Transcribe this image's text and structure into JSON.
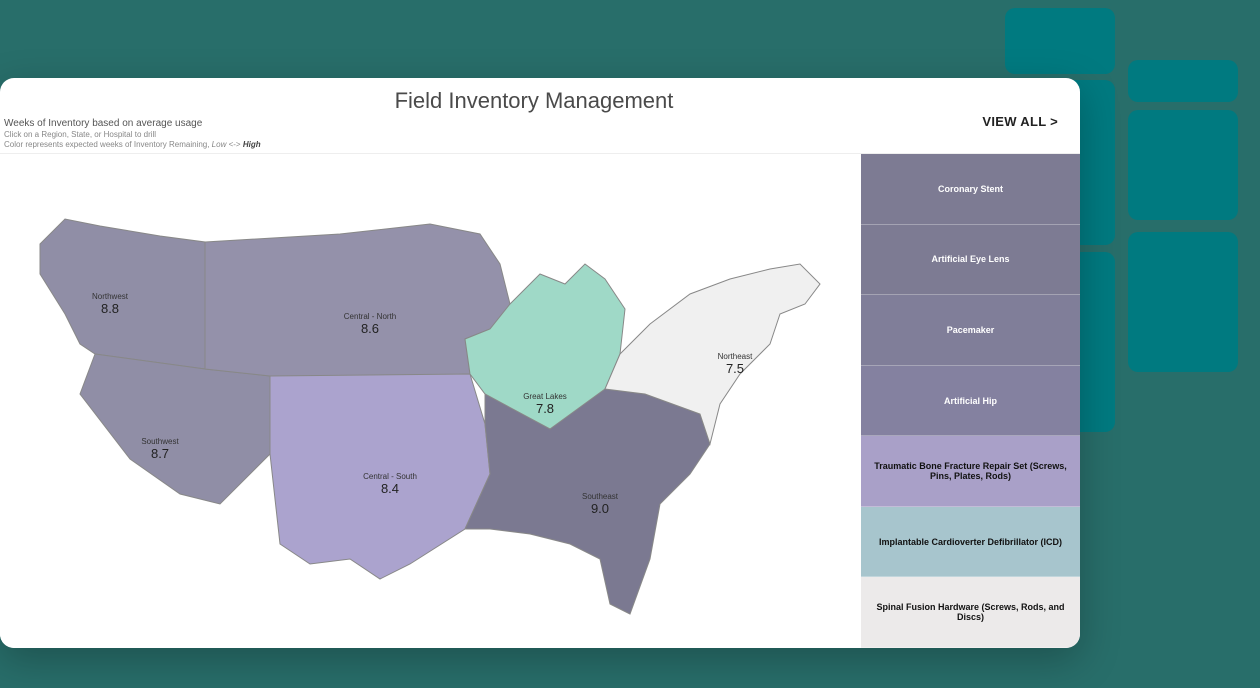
{
  "title": "Field Inventory Management",
  "subtitle1": "Weeks of Inventory based on average usage",
  "subtitle2": "Click on a Region, State, or Hospital to drill",
  "subtitle3_prefix": "Color represents expected weeks of Inventory Remaining, ",
  "subtitle3_low": "Low",
  "subtitle3_sep": " <-> ",
  "subtitle3_high": "High",
  "view_all": "VIEW ALL >",
  "regions": {
    "northwest": {
      "name": "Northwest",
      "value": "8.8",
      "color": "#908ea6"
    },
    "southwest": {
      "name": "Southwest",
      "value": "8.7",
      "color": "#908ea6"
    },
    "central_north": {
      "name": "Central - North",
      "value": "8.6",
      "color": "#9491aa"
    },
    "central_south": {
      "name": "Central - South",
      "value": "8.4",
      "color": "#aba3ce"
    },
    "great_lakes": {
      "name": "Great Lakes",
      "value": "7.8",
      "color": "#9fd9c7"
    },
    "southeast": {
      "name": "Southeast",
      "value": "9.0",
      "color": "#7b7991"
    },
    "northeast": {
      "name": "Northeast",
      "value": "7.5",
      "color": "#f0f0f0"
    }
  },
  "products": [
    "Coronary Stent",
    "Artificial Eye Lens",
    "Pacemaker",
    "Artificial Hip",
    "Traumatic Bone Fracture Repair Set (Screws, Pins, Plates, Rods)",
    "Implantable Cardioverter Defibrillator (ICD)",
    "Spinal Fusion Hardware (Screws, Rods, and Discs)"
  ],
  "chart_data": {
    "type": "choropleth-map",
    "title": "Weeks of Inventory based on average usage",
    "unit": "weeks",
    "regions": [
      {
        "name": "Northwest",
        "value": 8.8
      },
      {
        "name": "Southwest",
        "value": 8.7
      },
      {
        "name": "Central - North",
        "value": 8.6
      },
      {
        "name": "Central - South",
        "value": 8.4
      },
      {
        "name": "Great Lakes",
        "value": 7.8
      },
      {
        "name": "Southeast",
        "value": 9.0
      },
      {
        "name": "Northeast",
        "value": 7.5
      }
    ],
    "color_scale": {
      "low": "#f0f0f0",
      "mid": "#9fd9c7",
      "high": "#7b7991"
    },
    "legend": "Color represents expected weeks of Inventory Remaining, Low <-> High"
  }
}
